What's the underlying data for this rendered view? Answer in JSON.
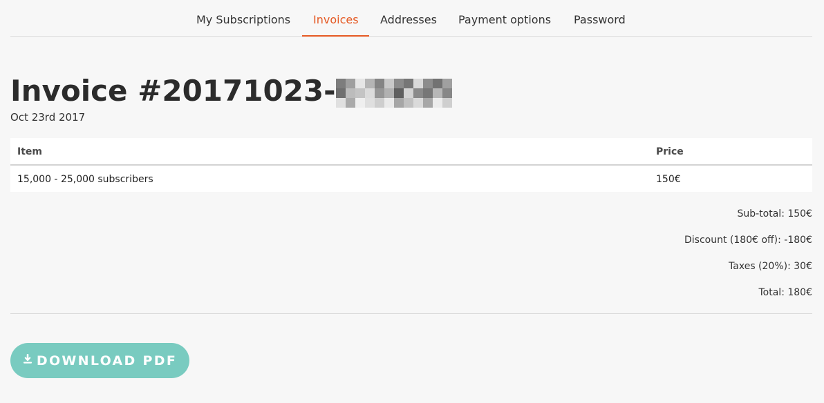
{
  "tabs": [
    {
      "label": "My Subscriptions",
      "active": false
    },
    {
      "label": "Invoices",
      "active": true
    },
    {
      "label": "Addresses",
      "active": false
    },
    {
      "label": "Payment options",
      "active": false
    },
    {
      "label": "Password",
      "active": false
    }
  ],
  "invoice": {
    "title": "Invoice #20171023-",
    "date": "Oct 23rd 2017"
  },
  "table": {
    "headers": {
      "item": "Item",
      "price": "Price"
    },
    "rows": [
      {
        "item": "15,000 - 25,000 subscribers",
        "price": "150€"
      }
    ]
  },
  "summary": {
    "subtotal": "Sub-total: 150€",
    "discount": "Discount (180€ off): -180€",
    "taxes": "Taxes (20%): 30€",
    "total": "Total: 180€"
  },
  "actions": {
    "download_label": "DOWNLOAD PDF"
  },
  "icons": {
    "download": "download-icon"
  },
  "colors": {
    "page_bg": "#f7f7f7",
    "accent": "#e55923",
    "button": "#79cbc0",
    "table_bg": "#ffffff"
  }
}
